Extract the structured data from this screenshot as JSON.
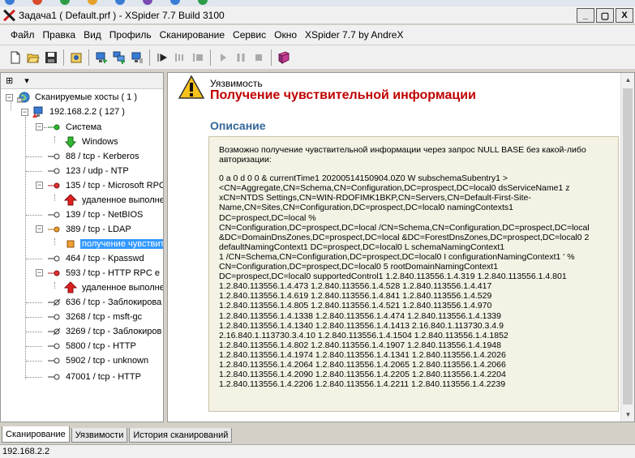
{
  "window": {
    "title": "Задача1 ( Default.prf ) - XSpider 7.7 Build 3100",
    "minimize": "_",
    "maximize": "▢",
    "close": "X"
  },
  "menu": [
    "Файл",
    "Правка",
    "Вид",
    "Профиль",
    "Сканирование",
    "Сервис",
    "Окно",
    "XSpider 7.7 by AndreX"
  ],
  "toolbar_icons": [
    "new-icon",
    "open-icon",
    "save-icon",
    "profile-icon",
    "add-host-icon",
    "add-hosts-icon",
    "host-settings-icon",
    "start-icon",
    "pause-all-icon",
    "stop-all-icon",
    "play-icon",
    "pause-icon",
    "stop-icon",
    "help-book-icon"
  ],
  "tree": {
    "root": "Сканируемые хосты ( 1 )",
    "host": "192.168.2.2 ( 127 )",
    "nodes": [
      "Система",
      "Windows",
      "88 / tcp - Kerberos",
      "123 / udp - NTP",
      "135 / tcp - Microsoft RPC",
      "удаленное выполнение",
      "139 / tcp - NetBIOS",
      "389 / tcp - LDAP",
      "получение чувствит",
      "464 / tcp - Kpasswd",
      "593 / tcp - HTTP RPC e",
      "удаленное выполнение",
      "636 / tcp - Заблокирова",
      "3268 / tcp - msft-gc",
      "3269 / tcp - Заблокиров",
      "5800 / tcp - HTTP",
      "5902 / tcp - unknown",
      "47001 / tcp - HTTP"
    ]
  },
  "detail": {
    "category": "Уязвимость",
    "title": "Получение чувствительной информации",
    "section": "Описание",
    "intro": "Возможно получение чувствительной информации через запрос NULL BASE без какой-либо авторизации:",
    "lines": [
      "0 a 0 d 0 0 & currentTime1 20200514150904.0Z0 W subschemaSubentry1 >",
      "<CN=Aggregate,CN=Schema,CN=Configuration,DC=prospect,DC=local0 dsServiceName1 z",
      "xCN=NTDS Settings,CN=WIN-RDOFIMK1BKP,CN=Servers,CN=Default-First-Site-",
      "Name,CN=Sites,CN=Configuration,DC=prospect,DC=local0 namingContexts1",
      "DC=prospect,DC=local %",
      "CN=Configuration,DC=prospect,DC=local /CN=Schema,CN=Configuration,DC=prospect,DC=local",
      "&DC=DomainDnsZones,DC=prospect,DC=local &DC=ForestDnsZones,DC=prospect,DC=local0 2",
      "defaultNamingContext1 DC=prospect,DC=local0 L schemaNamingContext1",
      "1 /CN=Schema,CN=Configuration,DC=prospect,DC=local0 I configurationNamingContext1 ' %",
      "CN=Configuration,DC=prospect,DC=local0 5 rootDomainNamingContext1",
      "DC=prospect,DC=local0 supportedControl1 1.2.840.113556.1.4.319 1.2.840.113556.1.4.801",
      "1.2.840.113556.1.4.473 1.2.840.113556.1.4.528 1.2.840.113556.1.4.417",
      "1.2.840.113556.1.4.619 1.2.840.113556.1.4.841 1.2.840.113556.1.4.529",
      "1.2.840.113556.1.4.805 1.2.840.113556.1.4.521 1.2.840.113556.1.4.970",
      "1.2.840.113556.1.4.1338 1.2.840.113556.1.4.474 1.2.840.113556.1.4.1339",
      "1.2.840.113556.1.4.1340 1.2.840.113556.1.4.1413 2.16.840.1.113730.3.4.9",
      "2.16.840.1.113730.3.4.10 1.2.840.113556.1.4.1504 1.2.840.113556.1.4.1852",
      "1.2.840.113556.1.4.802 1.2.840.113556.1.4.1907 1.2.840.113556.1.4.1948",
      "1.2.840.113556.1.4.1974 1.2.840.113556.1.4.1341 1.2.840.113556.1.4.2026",
      "1.2.840.113556.1.4.2064 1.2.840.113556.1.4.2065 1.2.840.113556.1.4.2066",
      "1.2.840.113556.1.4.2090 1.2.840.113556.1.4.2205 1.2.840.113556.1.4.2204",
      "1.2.840.113556.1.4.2206 1.2.840.113556.1.4.2211 1.2.840.113556.1.4.2239"
    ]
  },
  "tabs": [
    "Сканирование",
    "Уязвимости",
    "История сканирований"
  ],
  "status": {
    "text": "192.168.2.2"
  }
}
